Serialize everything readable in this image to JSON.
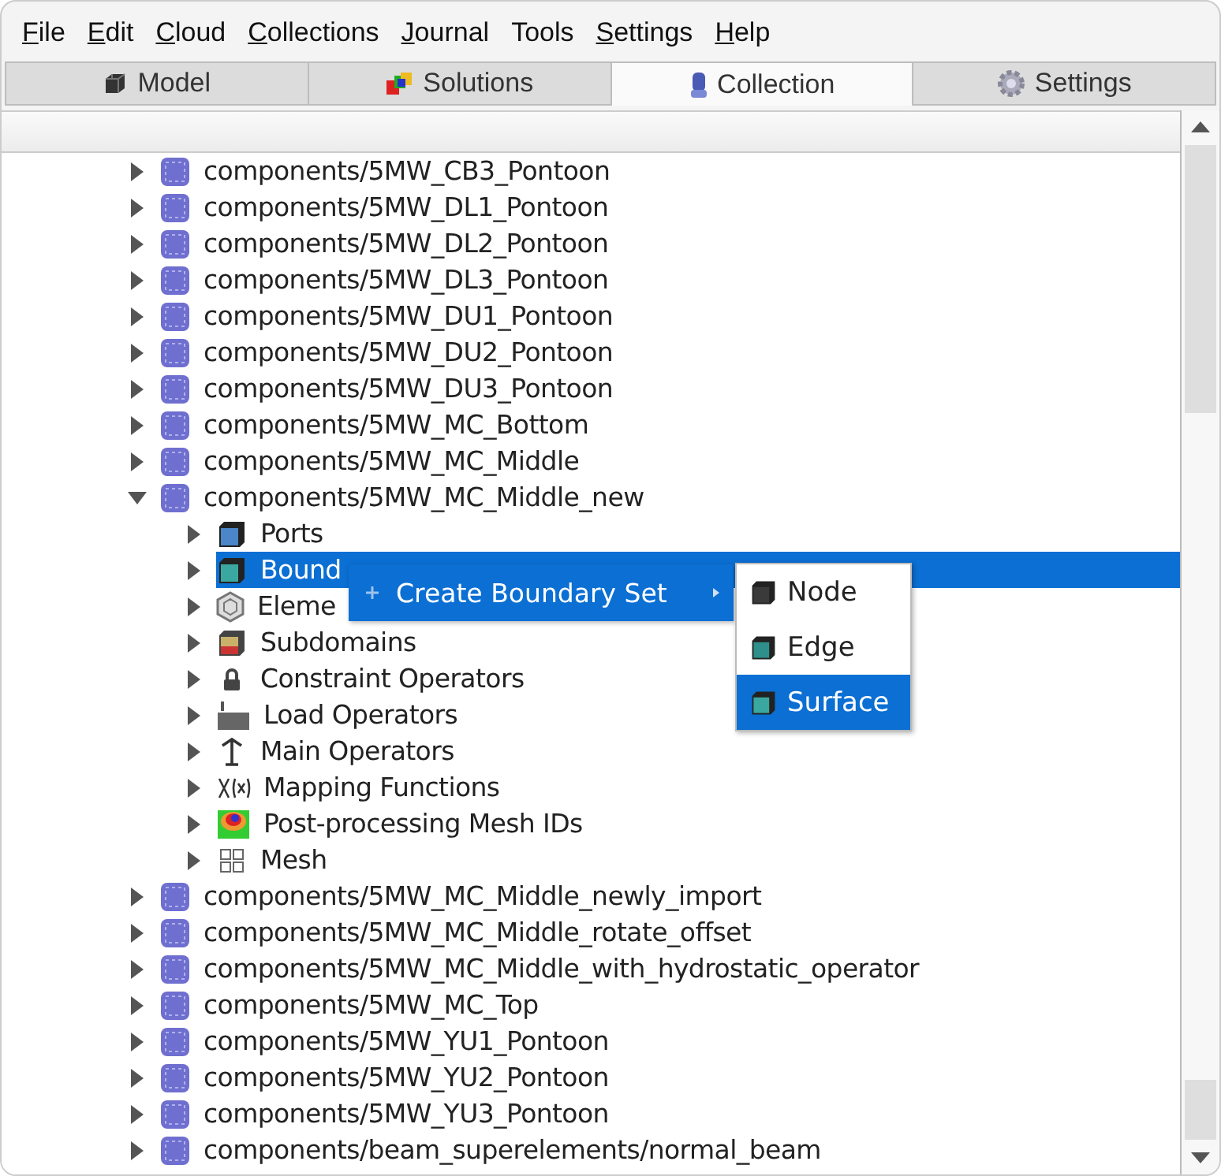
{
  "menu_bar": [
    {
      "mnemonic": "F",
      "rest": "ile"
    },
    {
      "mnemonic": "E",
      "rest": "dit"
    },
    {
      "mnemonic": "C",
      "rest": "loud"
    },
    {
      "mnemonic": "C",
      "rest": "ollections"
    },
    {
      "mnemonic": "J",
      "rest": "ournal"
    },
    {
      "rest": "Tools"
    },
    {
      "mnemonic": "S",
      "rest": "ettings"
    },
    {
      "mnemonic": "H",
      "rest": "elp"
    }
  ],
  "tabs": [
    {
      "label": "Model",
      "kind": "model",
      "selected": false
    },
    {
      "label": "Solutions",
      "kind": "solutions",
      "selected": false
    },
    {
      "label": "Collection",
      "kind": "collection",
      "selected": true
    },
    {
      "label": "Settings",
      "kind": "settings",
      "selected": false
    }
  ],
  "tree": {
    "items": [
      {
        "label": "components/5MW_CB3_Pontoon",
        "kind": "component",
        "expanded": false,
        "selected": false
      },
      {
        "label": "components/5MW_DL1_Pontoon",
        "kind": "component",
        "expanded": false,
        "selected": false
      },
      {
        "label": "components/5MW_DL2_Pontoon",
        "kind": "component",
        "expanded": false,
        "selected": false
      },
      {
        "label": "components/5MW_DL3_Pontoon",
        "kind": "component",
        "expanded": false,
        "selected": false
      },
      {
        "label": "components/5MW_DU1_Pontoon",
        "kind": "component",
        "expanded": false,
        "selected": false
      },
      {
        "label": "components/5MW_DU2_Pontoon",
        "kind": "component",
        "expanded": false,
        "selected": false
      },
      {
        "label": "components/5MW_DU3_Pontoon",
        "kind": "component",
        "expanded": false,
        "selected": false
      },
      {
        "label": "components/5MW_MC_Bottom",
        "kind": "component",
        "expanded": false,
        "selected": false
      },
      {
        "label": "components/5MW_MC_Middle",
        "kind": "component",
        "expanded": false,
        "selected": false
      },
      {
        "label": "components/5MW_MC_Middle_new",
        "kind": "component",
        "expanded": true,
        "selected": false,
        "children": [
          {
            "label": "Ports",
            "kind": "ports",
            "expanded": false,
            "selected": false
          },
          {
            "label": "Bound",
            "kind": "boundary",
            "expanded": false,
            "selected": true
          },
          {
            "label": "Eleme",
            "kind": "elements",
            "expanded": false,
            "selected": false
          },
          {
            "label": "Subdomains",
            "kind": "subdomains",
            "expanded": false,
            "selected": false
          },
          {
            "label": "Constraint Operators",
            "kind": "constraint",
            "expanded": false,
            "selected": false
          },
          {
            "label": "Load Operators",
            "kind": "load",
            "expanded": false,
            "selected": false
          },
          {
            "label": "Main Operators",
            "kind": "main",
            "expanded": false,
            "selected": false
          },
          {
            "label": "Mapping Functions",
            "kind": "mapping",
            "expanded": false,
            "selected": false
          },
          {
            "label": "Post-processing Mesh IDs",
            "kind": "postproc",
            "expanded": false,
            "selected": false
          },
          {
            "label": "Mesh",
            "kind": "mesh",
            "expanded": false,
            "selected": false
          }
        ]
      },
      {
        "label": "components/5MW_MC_Middle_newly_import",
        "kind": "component",
        "expanded": false,
        "selected": false
      },
      {
        "label": "components/5MW_MC_Middle_rotate_offset",
        "kind": "component",
        "expanded": false,
        "selected": false
      },
      {
        "label": "components/5MW_MC_Middle_with_hydrostatic_operator",
        "kind": "component",
        "expanded": false,
        "selected": false
      },
      {
        "label": "components/5MW_MC_Top",
        "kind": "component",
        "expanded": false,
        "selected": false
      },
      {
        "label": "components/5MW_YU1_Pontoon",
        "kind": "component",
        "expanded": false,
        "selected": false
      },
      {
        "label": "components/5MW_YU2_Pontoon",
        "kind": "component",
        "expanded": false,
        "selected": false
      },
      {
        "label": "components/5MW_YU3_Pontoon",
        "kind": "component",
        "expanded": false,
        "selected": false
      },
      {
        "label": "components/beam_superelements/normal_beam",
        "kind": "component",
        "expanded": false,
        "selected": false
      }
    ]
  },
  "context_menu": {
    "items": [
      {
        "label": "Create Boundary Set",
        "selected": true
      }
    ]
  },
  "submenu": {
    "items": [
      {
        "label": "Node",
        "kind": "node",
        "selected": false
      },
      {
        "label": "Edge",
        "kind": "edge",
        "selected": false
      },
      {
        "label": "Surface",
        "kind": "surface",
        "selected": true
      }
    ]
  }
}
